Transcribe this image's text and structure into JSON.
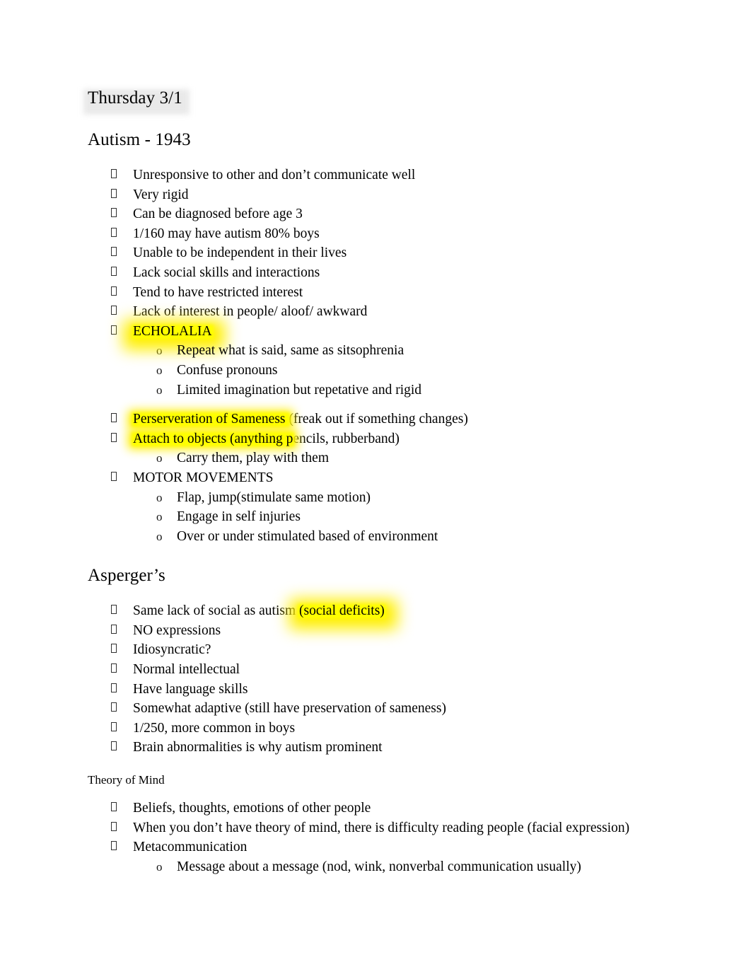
{
  "document": {
    "title": "Thursday 3/1",
    "bullet_glyph": "tofu-box",
    "sub_bullet_glyph": "o",
    "highlight_color": "#ffff00",
    "title_shade_color": "#e9e9e9",
    "text_color": "#000000"
  },
  "sections": [
    {
      "heading": "Autism - 1943",
      "items": [
        {
          "text": "Unresponsive to other and don’t communicate well",
          "level": 1,
          "highlight": "none"
        },
        {
          "text": "Very rigid",
          "level": 1,
          "highlight": "none"
        },
        {
          "text": "Can be diagnosed before age 3",
          "level": 1,
          "highlight": "none"
        },
        {
          "text": "1/160 may have autism 80% boys",
          "level": 1,
          "highlight": "none"
        },
        {
          "text": "Unable to be independent in their lives",
          "level": 1,
          "highlight": "none"
        },
        {
          "text": "Lack social skills and interactions",
          "level": 1,
          "highlight": "none"
        },
        {
          "text": "Tend to have restricted interest",
          "level": 1,
          "highlight": "none"
        },
        {
          "text": "Lack of interest in people/ aloof/ awkward",
          "level": 1,
          "highlight": "none"
        },
        {
          "text": "ECHOLALIA",
          "level": 1,
          "highlight": "full"
        },
        {
          "text": "Repeat what is said, same as sitsophrenia",
          "level": 2,
          "highlight": "none"
        },
        {
          "text": "Confuse pronouns",
          "level": 2,
          "highlight": "none"
        },
        {
          "text": "Limited imagination but repetative and rigid",
          "level": 2,
          "highlight": "none"
        },
        {
          "highlighted": "Perserveration of Sameness ",
          "plain": "(freak out if something changes)",
          "level": 1,
          "highlight": "partial"
        },
        {
          "highlighted": "Attach to objects (anything p",
          "plain": "encils, rubberband)",
          "level": 1,
          "highlight": "partial"
        },
        {
          "text": "Carry them, play with them",
          "level": 2,
          "highlight": "none"
        },
        {
          "text": "MOTOR MOVEMENTS",
          "level": 1,
          "highlight": "none"
        },
        {
          "text": "Flap, jump(stimulate same motion)",
          "level": 2,
          "highlight": "none"
        },
        {
          "text": "Engage in self injuries",
          "level": 2,
          "highlight": "none"
        },
        {
          "text": "Over or under stimulated based of environment",
          "level": 2,
          "highlight": "none"
        }
      ]
    },
    {
      "heading": "Asperger’s",
      "items": [
        {
          "plain": "Same lack of social as autism ",
          "highlighted": "(social deficits)",
          "level": 1,
          "highlight": "partial-trailing"
        },
        {
          "text": "NO expressions",
          "level": 1,
          "highlight": "none"
        },
        {
          "text": "Idiosyncratic?",
          "level": 1,
          "highlight": "none"
        },
        {
          "text": "Normal intellectual",
          "level": 1,
          "highlight": "none"
        },
        {
          "text": "Have language skills",
          "level": 1,
          "highlight": "none"
        },
        {
          "text": "Somewhat adaptive (still have preservation of sameness)",
          "level": 1,
          "highlight": "none"
        },
        {
          "text": "1/250, more common in boys",
          "level": 1,
          "highlight": "none"
        },
        {
          "text": "Brain abnormalities is why autism prominent",
          "level": 1,
          "highlight": "none"
        }
      ],
      "sub_label": "Theory of Mind",
      "sub_items": [
        {
          "text": "Beliefs, thoughts, emotions of other people",
          "level": 1,
          "highlight": "none"
        },
        {
          "text": "When you don’t have theory of mind, there is difficulty reading people (facial expression)",
          "level": 1,
          "highlight": "none"
        },
        {
          "text": "Metacommunication",
          "level": 1,
          "highlight": "none"
        },
        {
          "text": "Message about a message (nod, wink, nonverbal communication usually)",
          "level": 2,
          "highlight": "none"
        }
      ]
    }
  ]
}
